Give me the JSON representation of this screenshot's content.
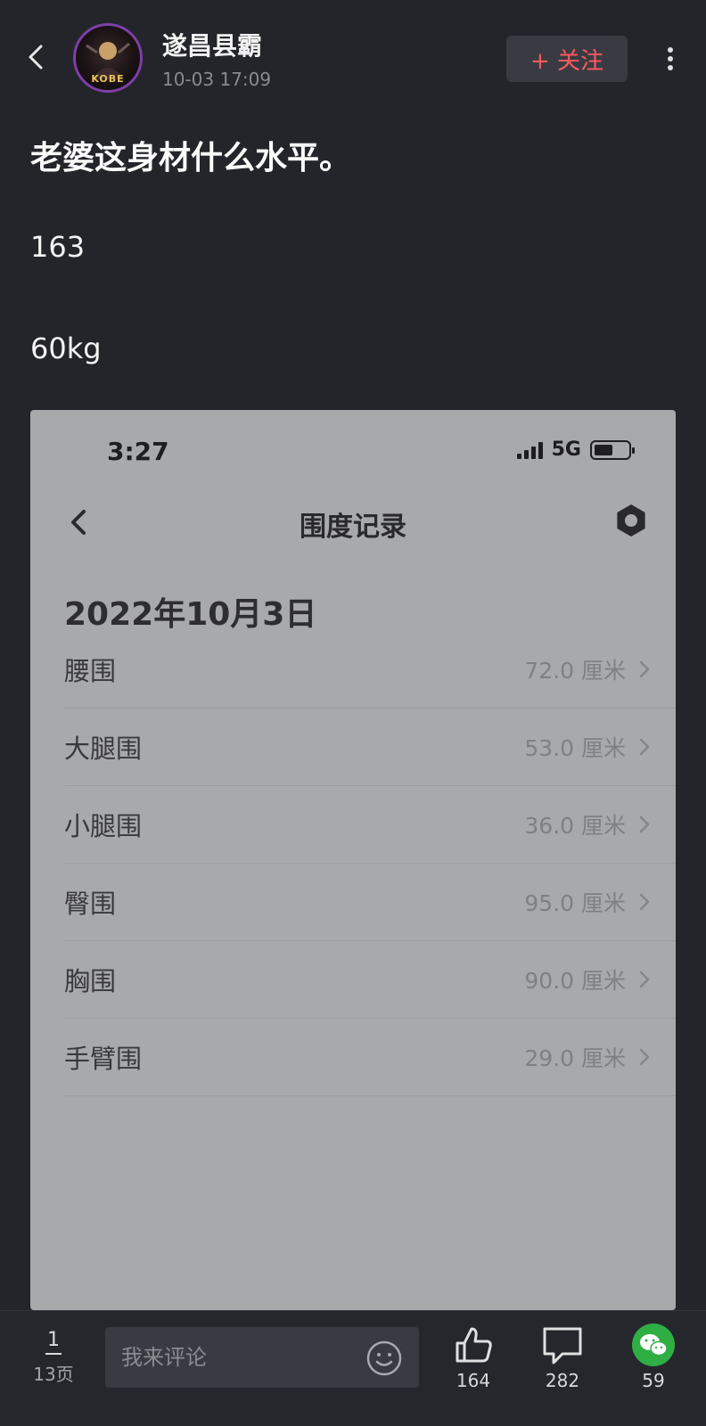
{
  "header": {
    "username": "遂昌县霸",
    "post_time": "10-03 17:09",
    "follow_label": "+ 关注",
    "avatar_text": "KOBE"
  },
  "post": {
    "title": "老婆这身材什么水平。",
    "lines": [
      "163",
      "60kg"
    ]
  },
  "screenshot": {
    "status_time": "3:27",
    "network": "5G",
    "battery_level": 0.55,
    "page_title": "围度记录",
    "date": "2022年10月3日",
    "rows": [
      {
        "label": "腰围",
        "value": "72.0 厘米"
      },
      {
        "label": "大腿围",
        "value": "53.0 厘米"
      },
      {
        "label": "小腿围",
        "value": "36.0 厘米"
      },
      {
        "label": "臀围",
        "value": "95.0 厘米"
      },
      {
        "label": "胸围",
        "value": "90.0 厘米"
      },
      {
        "label": "手臂围",
        "value": "29.0 厘米"
      }
    ]
  },
  "bottom_bar": {
    "current_page": "1",
    "total_pages": "13页",
    "comment_placeholder": "我来评论",
    "like_count": "164",
    "comment_count": "282",
    "share_count": "59"
  },
  "colors": {
    "background": "#24252b",
    "follow_text": "#ff5a5f",
    "wechat_green": "#2fae44"
  },
  "icons": [
    "back-icon",
    "more-icon",
    "signal-icon",
    "battery-icon",
    "settings-icon",
    "chevron-right-icon",
    "emoji-icon",
    "thumbs-up-icon",
    "comment-icon",
    "wechat-icon"
  ]
}
